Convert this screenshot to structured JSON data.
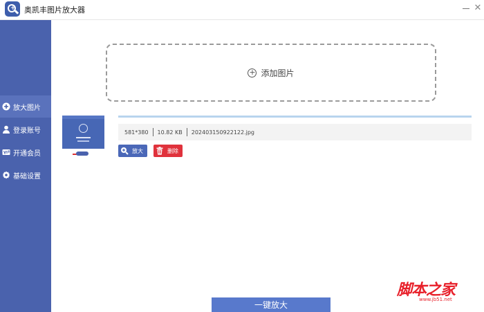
{
  "window": {
    "title": "奥凯丰图片放大器"
  },
  "sidebar": {
    "items": [
      {
        "label": "放大图片",
        "icon": "plus-circle-icon",
        "active": true
      },
      {
        "label": "登录账号",
        "icon": "user-icon",
        "active": false
      },
      {
        "label": "开通会员",
        "icon": "vip-icon",
        "active": false
      },
      {
        "label": "基础设置",
        "icon": "gear-icon",
        "active": false
      }
    ]
  },
  "main": {
    "dropzone_label": "添加图片",
    "file": {
      "dimensions": "581*380",
      "size": "10.82 KB",
      "name": "202403150922122.jpg",
      "progress": 1.0
    },
    "zoom_button": "放大",
    "delete_button": "删除",
    "one_click_button": "一键放大"
  },
  "watermark": {
    "text": "脚本之家",
    "url": "www.jb51.net"
  },
  "colors": {
    "sidebar": "#4a62ad",
    "accent": "#5879cc",
    "danger": "#e0323c",
    "watermark": "#e8202a"
  }
}
